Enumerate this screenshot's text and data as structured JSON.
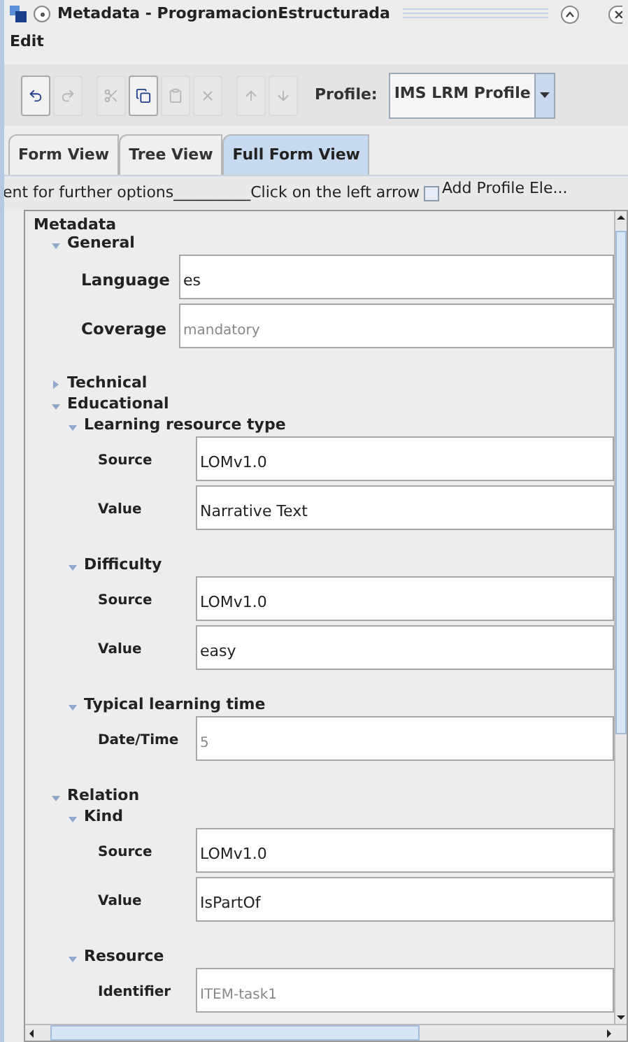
{
  "window": {
    "title": "Metadata - ProgramacionEstructurada"
  },
  "menu": [
    {
      "label": "Edit"
    }
  ],
  "toolbar": [
    {
      "kind": "undo",
      "disabled": false
    },
    {
      "kind": "redo",
      "disabled": true
    },
    {
      "kind": "cut",
      "disabled": true
    },
    {
      "kind": "copy",
      "disabled": false
    },
    {
      "kind": "paste",
      "disabled": true
    },
    {
      "kind": "delete",
      "disabled": true
    },
    {
      "kind": "up",
      "disabled": true
    },
    {
      "kind": "down",
      "disabled": true
    }
  ],
  "profile": {
    "label": "Profile:",
    "value": "IMS LRM Profile"
  },
  "tabs": [
    {
      "label": "Form View",
      "selected": false
    },
    {
      "label": "Tree View",
      "selected": false
    },
    {
      "label": "Full Form View",
      "selected": true
    }
  ],
  "hint": "ent for further options__________Click on the left arrow",
  "add_profile": {
    "label": "Add Profile Ele...",
    "checked": false
  },
  "form": {
    "label": "Metadata",
    "children": [
      {
        "kind": "group",
        "label": "General",
        "expanded": true,
        "children": [
          {
            "kind": "field",
            "label": "Language",
            "value": "es",
            "dimmed": false
          },
          {
            "kind": "field",
            "label": "Coverage",
            "value": "mandatory",
            "dimmed": true
          }
        ]
      },
      {
        "kind": "group",
        "label": "Technical",
        "expanded": false
      },
      {
        "kind": "group",
        "label": "Educational",
        "expanded": true,
        "children": [
          {
            "kind": "group",
            "label": "Learning resource type",
            "expanded": true,
            "children": [
              {
                "kind": "field",
                "label": "Source",
                "value": "LOMv1.0",
                "dimmed": false
              },
              {
                "kind": "field",
                "label": "Value",
                "value": "Narrative Text",
                "dimmed": false
              }
            ]
          },
          {
            "kind": "group",
            "label": "Difficulty",
            "expanded": true,
            "children": [
              {
                "kind": "field",
                "label": "Source",
                "value": "LOMv1.0",
                "dimmed": false
              },
              {
                "kind": "field",
                "label": "Value",
                "value": "easy",
                "dimmed": false
              }
            ]
          },
          {
            "kind": "group",
            "label": "Typical learning time",
            "expanded": true,
            "children": [
              {
                "kind": "field",
                "label": "Date/Time",
                "value": "5",
                "dimmed": true
              }
            ]
          }
        ]
      },
      {
        "kind": "group",
        "label": "Relation",
        "expanded": true,
        "children": [
          {
            "kind": "group",
            "label": "Kind",
            "expanded": true,
            "children": [
              {
                "kind": "field",
                "label": "Source",
                "value": "LOMv1.0",
                "dimmed": false
              },
              {
                "kind": "field",
                "label": "Value",
                "value": "IsPartOf",
                "dimmed": false
              }
            ]
          },
          {
            "kind": "group",
            "label": "Resource",
            "expanded": true,
            "children": [
              {
                "kind": "field",
                "label": "Identifier",
                "value": "ITEM-task1",
                "dimmed": true
              }
            ]
          }
        ]
      }
    ]
  }
}
